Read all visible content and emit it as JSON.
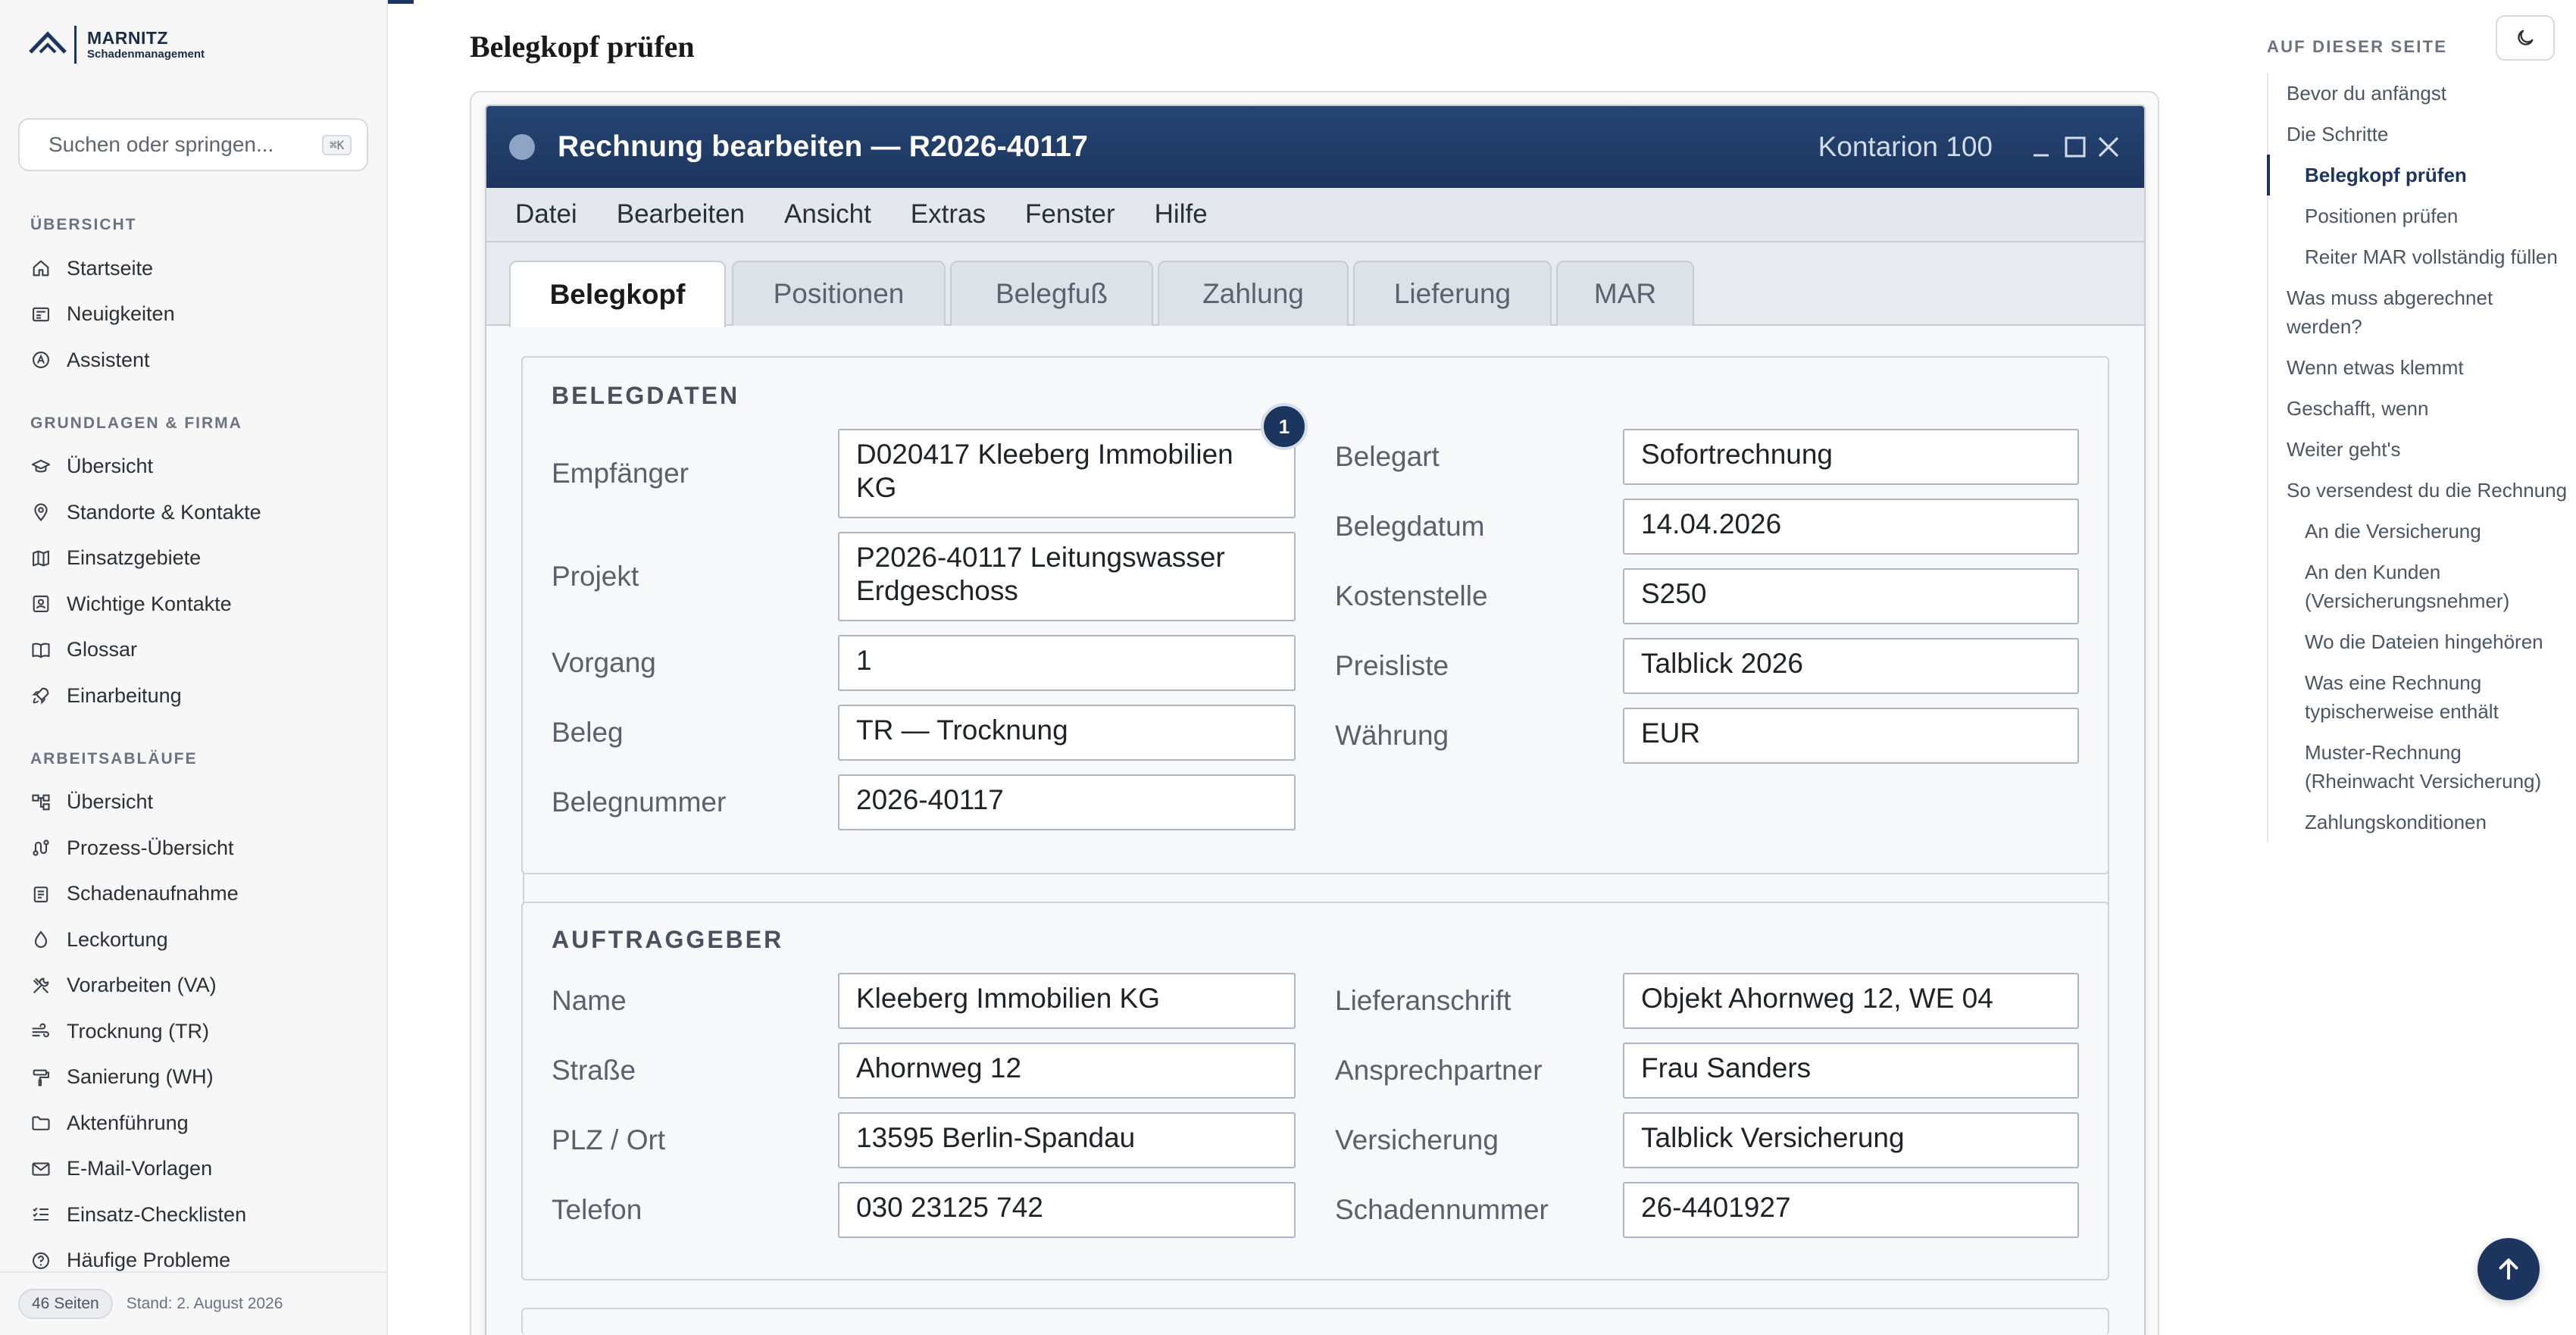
{
  "brand": {
    "name": "MARNITZ",
    "subtitle": "Schadenmanagement"
  },
  "search": {
    "placeholder": "Suchen oder springen...",
    "shortcut": "⌘K"
  },
  "nav": {
    "sections": [
      {
        "heading": "ÜBERSICHT",
        "items": [
          {
            "label": "Startseite",
            "icon": "home-icon"
          },
          {
            "label": "Neuigkeiten",
            "icon": "news-icon"
          },
          {
            "label": "Assistent",
            "icon": "assistant-icon"
          }
        ]
      },
      {
        "heading": "GRUNDLAGEN & FIRMA",
        "items": [
          {
            "label": "Übersicht",
            "icon": "graduation-cap-icon"
          },
          {
            "label": "Standorte & Kontakte",
            "icon": "map-pin-icon"
          },
          {
            "label": "Einsatzgebiete",
            "icon": "map-icon"
          },
          {
            "label": "Wichtige Kontakte",
            "icon": "contact-card-icon"
          },
          {
            "label": "Glossar",
            "icon": "book-icon"
          },
          {
            "label": "Einarbeitung",
            "icon": "rocket-icon"
          }
        ]
      },
      {
        "heading": "ARBEITSABLÄUFE",
        "items": [
          {
            "label": "Übersicht",
            "icon": "workflow-icon"
          },
          {
            "label": "Prozess-Übersicht",
            "icon": "route-icon"
          },
          {
            "label": "Schadenaufnahme",
            "icon": "clipboard-icon"
          },
          {
            "label": "Leckortung",
            "icon": "droplet-icon"
          },
          {
            "label": "Vorarbeiten (VA)",
            "icon": "tools-icon"
          },
          {
            "label": "Trocknung (TR)",
            "icon": "wind-icon"
          },
          {
            "label": "Sanierung (WH)",
            "icon": "paint-roller-icon"
          },
          {
            "label": "Aktenführung",
            "icon": "folder-icon"
          },
          {
            "label": "E-Mail-Vorlagen",
            "icon": "mail-icon"
          },
          {
            "label": "Einsatz-Checklisten",
            "icon": "checklist-icon"
          },
          {
            "label": "Häufige Probleme",
            "icon": "help-circle-icon"
          }
        ]
      }
    ]
  },
  "footer": {
    "pages": "46 Seiten",
    "stand": "Stand: 2. August 2026"
  },
  "page": {
    "title": "Belegkopf prüfen"
  },
  "window": {
    "title": "Rechnung bearbeiten — R2026-40117",
    "product": "Kontarion 100",
    "menu": [
      "Datei",
      "Bearbeiten",
      "Ansicht",
      "Extras",
      "Fenster",
      "Hilfe"
    ],
    "tabs": [
      "Belegkopf",
      "Positionen",
      "Belegfuß",
      "Zahlung",
      "Lieferung",
      "MAR"
    ],
    "active_tab": "Belegkopf"
  },
  "belegdaten": {
    "title": "BELEGDATEN",
    "marker": "1",
    "left": [
      {
        "label": "Empfänger",
        "value": "D020417   Kleeberg Immobilien KG"
      },
      {
        "label": "Projekt",
        "value": "P2026-40117   Leitungswasser Erdgeschoss"
      },
      {
        "label": "Vorgang",
        "value": "1"
      },
      {
        "label": "Beleg",
        "value": "TR — Trocknung"
      },
      {
        "label": "Belegnummer",
        "value": "2026-40117"
      }
    ],
    "right": [
      {
        "label": "Belegart",
        "value": "Sofortrechnung"
      },
      {
        "label": "Belegdatum",
        "value": "14.04.2026"
      },
      {
        "label": "Kostenstelle",
        "value": "S250"
      },
      {
        "label": "Preisliste",
        "value": "Talblick 2026"
      },
      {
        "label": "Währung",
        "value": "EUR"
      }
    ]
  },
  "auftraggeber": {
    "title": "AUFTRAGGEBER",
    "left": [
      {
        "label": "Name",
        "value": "Kleeberg Immobilien KG"
      },
      {
        "label": "Straße",
        "value": "Ahornweg 12"
      },
      {
        "label": "PLZ / Ort",
        "value": "13595 Berlin-Spandau"
      },
      {
        "label": "Telefon",
        "value": "030 23125 742"
      }
    ],
    "right": [
      {
        "label": "Lieferanschrift",
        "value": "Objekt Ahornweg 12, WE 04"
      },
      {
        "label": "Ansprechpartner",
        "value": "Frau Sanders"
      },
      {
        "label": "Versicherung",
        "value": "Talblick Versicherung"
      },
      {
        "label": "Schadennummer",
        "value": "26-4401927"
      }
    ]
  },
  "toc": {
    "heading": "AUF DIESER SEITE",
    "items": [
      {
        "label": "Bevor du anfängst",
        "level": 1
      },
      {
        "label": "Die Schritte",
        "level": 1
      },
      {
        "label": "Belegkopf prüfen",
        "level": 2,
        "active": true
      },
      {
        "label": "Positionen prüfen",
        "level": 2
      },
      {
        "label": "Reiter MAR vollständig füllen",
        "level": 2
      },
      {
        "label": "Was muss abgerechnet werden?",
        "level": 1
      },
      {
        "label": "Wenn etwas klemmt",
        "level": 1
      },
      {
        "label": "Geschafft, wenn",
        "level": 1
      },
      {
        "label": "Weiter geht's",
        "level": 1
      },
      {
        "label": "So versendest du die Rechnung",
        "level": 1
      },
      {
        "label": "An die Versicherung",
        "level": 2
      },
      {
        "label": "An den Kunden (Versicherungsnehmer)",
        "level": 2
      },
      {
        "label": "Wo die Dateien hingehören",
        "level": 2
      },
      {
        "label": "Was eine Rechnung typischerweise enthält",
        "level": 2
      },
      {
        "label": "Muster-Rechnung (Rheinwacht Versicherung)",
        "level": 2
      },
      {
        "label": "Zahlungskonditionen",
        "level": 2
      }
    ]
  },
  "colors": {
    "accent": "#1c355e",
    "titlebar": "#264573"
  }
}
